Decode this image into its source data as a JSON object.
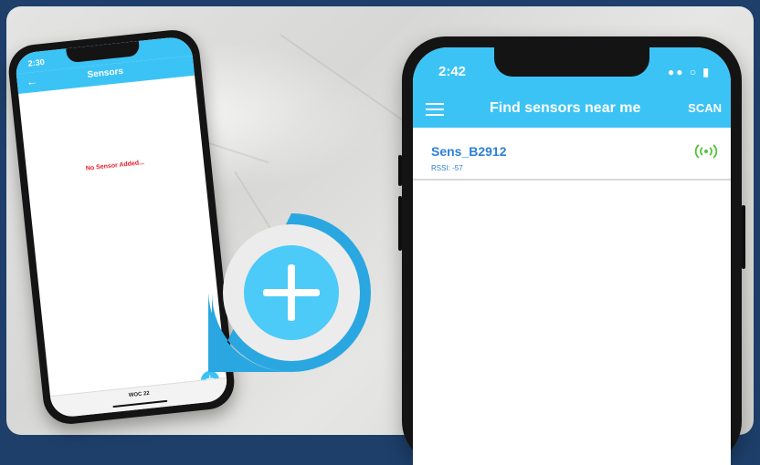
{
  "left_phone": {
    "time": "2:30",
    "title": "Sensors",
    "back_icon": "arrow-left-icon",
    "empty_message": "No Sensor Added...",
    "bottom_label": "WOC 22",
    "fab_label": "+"
  },
  "right_phone": {
    "time": "2:42",
    "status_icons": "signal-wifi-battery",
    "title": "Find sensors near me",
    "scan_label": "SCAN",
    "menu_icon": "hamburger-menu-icon",
    "sensors": [
      {
        "name": "Sens_B2912",
        "rssi": "RSSI: -57",
        "icon": "broadcast-signal-icon"
      }
    ]
  },
  "colors": {
    "app_bar": "#3cc3f5",
    "accent_blue": "#2d7fd8",
    "empty_red": "#e8202a",
    "signal_green": "#54c23a",
    "frame": "#1d3f6a"
  }
}
